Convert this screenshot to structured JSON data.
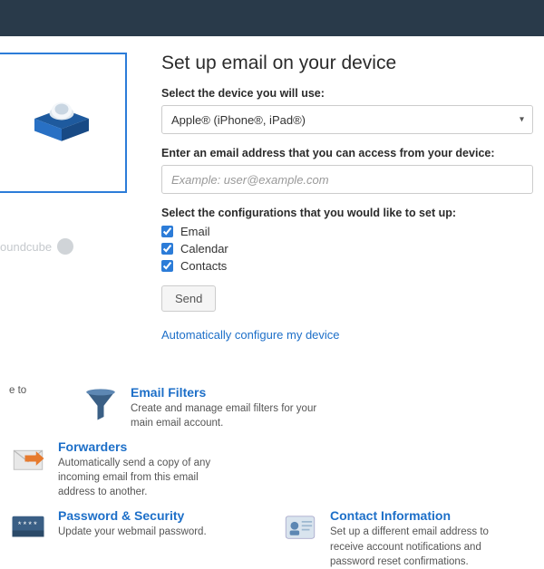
{
  "page_title": "Set up email on your device",
  "device": {
    "label": "Select the device you will use:",
    "selected": "Apple® (iPhone®, iPad®)"
  },
  "address": {
    "label": "Enter an email address that you can access from your device:",
    "placeholder": "Example: user@example.com"
  },
  "configs": {
    "label": "Select the configurations that you would like to set up:",
    "email": "Email",
    "calendar": "Calendar",
    "contacts": "Contacts"
  },
  "send_label": "Send",
  "auto_link": "Automatically configure my device",
  "roundcube": "oundcube",
  "frag_to": "e to",
  "features": {
    "filters": {
      "title": "Email Filters",
      "desc": "Create and manage email filters for your main email account."
    },
    "forwarders": {
      "title": "Forwarders",
      "desc": "Automatically send a copy of any incoming email from this email address to another."
    },
    "password": {
      "title": "Password & Security",
      "desc": "Update your webmail password."
    },
    "contact": {
      "title": "Contact Information",
      "desc": "Set up a different email address to receive account notifications and password reset confirmations."
    }
  }
}
